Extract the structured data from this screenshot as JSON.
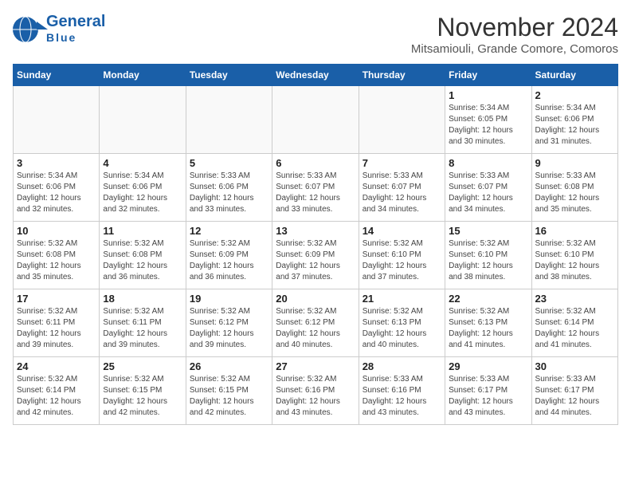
{
  "header": {
    "logo_line1": "General",
    "logo_line2": "Blue",
    "title": "November 2024",
    "subtitle": "Mitsamiouli, Grande Comore, Comoros"
  },
  "calendar": {
    "days_of_week": [
      "Sunday",
      "Monday",
      "Tuesday",
      "Wednesday",
      "Thursday",
      "Friday",
      "Saturday"
    ],
    "weeks": [
      [
        {
          "day": "",
          "info": ""
        },
        {
          "day": "",
          "info": ""
        },
        {
          "day": "",
          "info": ""
        },
        {
          "day": "",
          "info": ""
        },
        {
          "day": "",
          "info": ""
        },
        {
          "day": "1",
          "info": "Sunrise: 5:34 AM\nSunset: 6:05 PM\nDaylight: 12 hours and 30 minutes."
        },
        {
          "day": "2",
          "info": "Sunrise: 5:34 AM\nSunset: 6:06 PM\nDaylight: 12 hours and 31 minutes."
        }
      ],
      [
        {
          "day": "3",
          "info": "Sunrise: 5:34 AM\nSunset: 6:06 PM\nDaylight: 12 hours and 32 minutes."
        },
        {
          "day": "4",
          "info": "Sunrise: 5:34 AM\nSunset: 6:06 PM\nDaylight: 12 hours and 32 minutes."
        },
        {
          "day": "5",
          "info": "Sunrise: 5:33 AM\nSunset: 6:06 PM\nDaylight: 12 hours and 33 minutes."
        },
        {
          "day": "6",
          "info": "Sunrise: 5:33 AM\nSunset: 6:07 PM\nDaylight: 12 hours and 33 minutes."
        },
        {
          "day": "7",
          "info": "Sunrise: 5:33 AM\nSunset: 6:07 PM\nDaylight: 12 hours and 34 minutes."
        },
        {
          "day": "8",
          "info": "Sunrise: 5:33 AM\nSunset: 6:07 PM\nDaylight: 12 hours and 34 minutes."
        },
        {
          "day": "9",
          "info": "Sunrise: 5:33 AM\nSunset: 6:08 PM\nDaylight: 12 hours and 35 minutes."
        }
      ],
      [
        {
          "day": "10",
          "info": "Sunrise: 5:32 AM\nSunset: 6:08 PM\nDaylight: 12 hours and 35 minutes."
        },
        {
          "day": "11",
          "info": "Sunrise: 5:32 AM\nSunset: 6:08 PM\nDaylight: 12 hours and 36 minutes."
        },
        {
          "day": "12",
          "info": "Sunrise: 5:32 AM\nSunset: 6:09 PM\nDaylight: 12 hours and 36 minutes."
        },
        {
          "day": "13",
          "info": "Sunrise: 5:32 AM\nSunset: 6:09 PM\nDaylight: 12 hours and 37 minutes."
        },
        {
          "day": "14",
          "info": "Sunrise: 5:32 AM\nSunset: 6:10 PM\nDaylight: 12 hours and 37 minutes."
        },
        {
          "day": "15",
          "info": "Sunrise: 5:32 AM\nSunset: 6:10 PM\nDaylight: 12 hours and 38 minutes."
        },
        {
          "day": "16",
          "info": "Sunrise: 5:32 AM\nSunset: 6:10 PM\nDaylight: 12 hours and 38 minutes."
        }
      ],
      [
        {
          "day": "17",
          "info": "Sunrise: 5:32 AM\nSunset: 6:11 PM\nDaylight: 12 hours and 39 minutes."
        },
        {
          "day": "18",
          "info": "Sunrise: 5:32 AM\nSunset: 6:11 PM\nDaylight: 12 hours and 39 minutes."
        },
        {
          "day": "19",
          "info": "Sunrise: 5:32 AM\nSunset: 6:12 PM\nDaylight: 12 hours and 39 minutes."
        },
        {
          "day": "20",
          "info": "Sunrise: 5:32 AM\nSunset: 6:12 PM\nDaylight: 12 hours and 40 minutes."
        },
        {
          "day": "21",
          "info": "Sunrise: 5:32 AM\nSunset: 6:13 PM\nDaylight: 12 hours and 40 minutes."
        },
        {
          "day": "22",
          "info": "Sunrise: 5:32 AM\nSunset: 6:13 PM\nDaylight: 12 hours and 41 minutes."
        },
        {
          "day": "23",
          "info": "Sunrise: 5:32 AM\nSunset: 6:14 PM\nDaylight: 12 hours and 41 minutes."
        }
      ],
      [
        {
          "day": "24",
          "info": "Sunrise: 5:32 AM\nSunset: 6:14 PM\nDaylight: 12 hours and 42 minutes."
        },
        {
          "day": "25",
          "info": "Sunrise: 5:32 AM\nSunset: 6:15 PM\nDaylight: 12 hours and 42 minutes."
        },
        {
          "day": "26",
          "info": "Sunrise: 5:32 AM\nSunset: 6:15 PM\nDaylight: 12 hours and 42 minutes."
        },
        {
          "day": "27",
          "info": "Sunrise: 5:32 AM\nSunset: 6:16 PM\nDaylight: 12 hours and 43 minutes."
        },
        {
          "day": "28",
          "info": "Sunrise: 5:33 AM\nSunset: 6:16 PM\nDaylight: 12 hours and 43 minutes."
        },
        {
          "day": "29",
          "info": "Sunrise: 5:33 AM\nSunset: 6:17 PM\nDaylight: 12 hours and 43 minutes."
        },
        {
          "day": "30",
          "info": "Sunrise: 5:33 AM\nSunset: 6:17 PM\nDaylight: 12 hours and 44 minutes."
        }
      ]
    ]
  }
}
